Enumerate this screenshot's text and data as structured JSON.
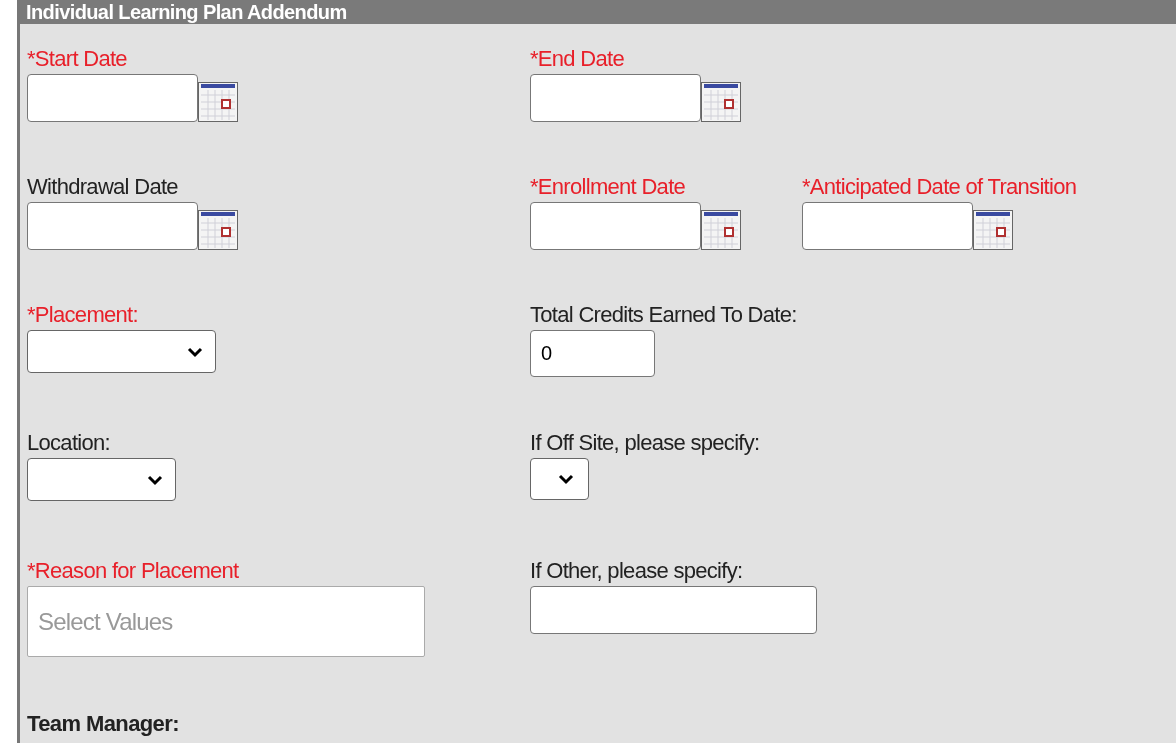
{
  "panel": {
    "title": "Individual Learning Plan Addendum"
  },
  "rows": [
    {
      "fields": [
        {
          "kind": "date",
          "label": "*Start Date",
          "required": true
        },
        {
          "kind": "date",
          "label": "*End Date",
          "required": true
        }
      ]
    },
    {
      "fields": [
        {
          "kind": "date",
          "label": "Withdrawal Date",
          "required": false
        },
        {
          "kind": "date",
          "label": "*Enrollment Date",
          "required": true
        },
        {
          "kind": "date",
          "label": "*Anticipated Date of Transition",
          "required": true
        }
      ]
    },
    {
      "fields": [
        {
          "kind": "select",
          "label": "*Placement:",
          "required": true
        },
        {
          "kind": "text",
          "label": "Total Credits Earned To Date:",
          "required": false,
          "value": "0"
        }
      ]
    },
    {
      "fields": [
        {
          "kind": "select",
          "label": "Location:",
          "required": false
        },
        {
          "kind": "select",
          "label": "If Off Site, please specify:",
          "required": false
        }
      ]
    },
    {
      "fields": [
        {
          "kind": "multiselect",
          "label": "*Reason for Placement",
          "required": true,
          "placeholder": "Select Values"
        },
        {
          "kind": "text",
          "label": "If Other, please specify:",
          "required": false
        }
      ]
    }
  ],
  "footer_label": "Team Manager:"
}
